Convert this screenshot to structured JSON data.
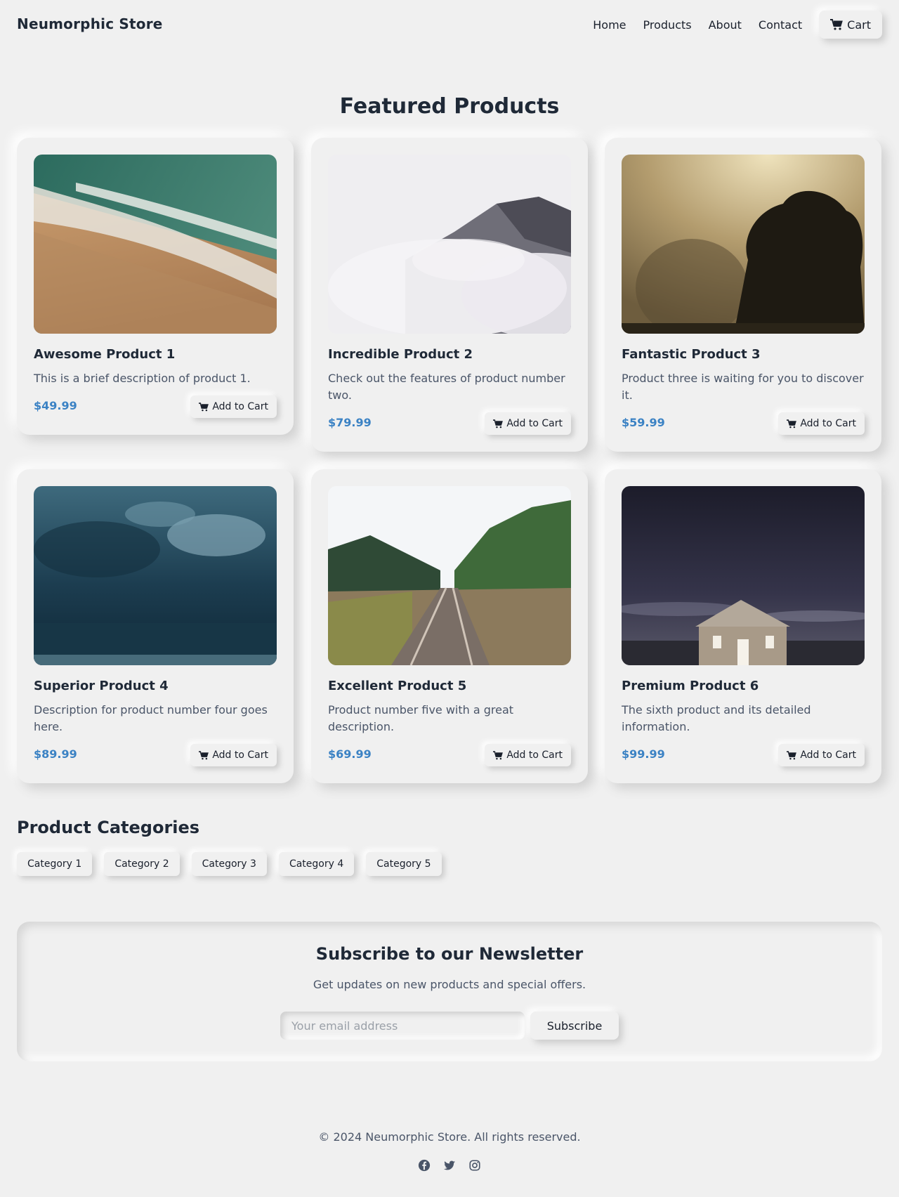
{
  "header": {
    "brand": "Neumorphic Store",
    "nav": [
      "Home",
      "Products",
      "About",
      "Contact"
    ],
    "cart_label": "Cart"
  },
  "featured": {
    "title": "Featured Products",
    "products": [
      {
        "title": "Awesome Product 1",
        "description": "This is a brief description of product 1.",
        "price": "$49.99",
        "button": "Add to Cart",
        "image": "beach waves"
      },
      {
        "title": "Incredible Product 2",
        "description": "Check out the features of product number two.",
        "price": "$79.99",
        "button": "Add to Cart",
        "image": "misty mountain"
      },
      {
        "title": "Fantastic Product 3",
        "description": "Product three is waiting for you to discover it.",
        "price": "$59.99",
        "button": "Add to Cart",
        "image": "foggy trees"
      },
      {
        "title": "Superior Product 4",
        "description": "Description for product number four goes here.",
        "price": "$89.99",
        "button": "Add to Cart",
        "image": "stormy sea"
      },
      {
        "title": "Excellent Product 5",
        "description": "Product number five with a great description.",
        "price": "$69.99",
        "button": "Add to Cart",
        "image": "railway tracks"
      },
      {
        "title": "Premium Product 6",
        "description": "The sixth product and its detailed information.",
        "price": "$99.99",
        "button": "Add to Cart",
        "image": "house at night"
      }
    ]
  },
  "categories": {
    "title": "Product Categories",
    "items": [
      "Category 1",
      "Category 2",
      "Category 3",
      "Category 4",
      "Category 5"
    ]
  },
  "newsletter": {
    "title": "Subscribe to our Newsletter",
    "subtitle": "Get updates on new products and special offers.",
    "placeholder": "Your email address",
    "button": "Subscribe"
  },
  "footer": {
    "copyright": "© 2024 Neumorphic Store. All rights reserved.",
    "socials": [
      "facebook-icon",
      "twitter-icon",
      "instagram-icon"
    ]
  },
  "colors": {
    "background": "#f0f0f0",
    "price": "#3b82c4",
    "heading": "#1f2937"
  }
}
